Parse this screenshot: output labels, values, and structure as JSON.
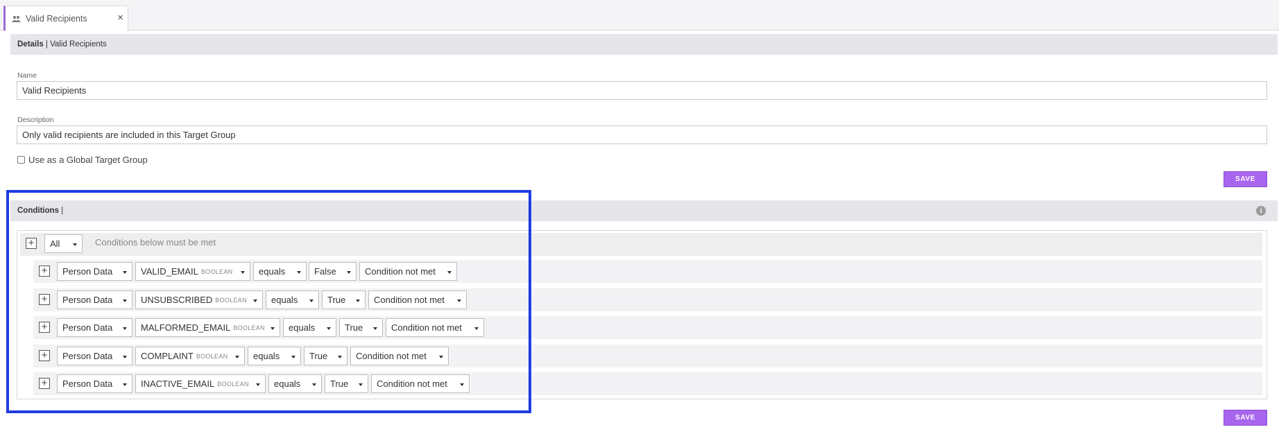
{
  "tab": {
    "title": "Valid Recipients",
    "close": "×",
    "icon": "users-icon"
  },
  "details": {
    "header_bold": "Details",
    "header_rest": " | Valid Recipients",
    "name_label": "Name",
    "name_value": "Valid Recipients",
    "description_label": "Description",
    "description_value": "Only valid recipients are included in this Target Group",
    "global_checkbox_label": "Use as a Global Target Group",
    "save_label": "SAVE"
  },
  "conditions": {
    "header_bold": "Conditions",
    "header_rest": " |",
    "info_icon": "i",
    "root_selector": "All",
    "root_text": "Conditions below must be met",
    "rows": [
      {
        "source": "Person Data",
        "field": "VALID_EMAIL",
        "type": "BOOLEAN",
        "operator": "equals",
        "value": "False",
        "negation": "Condition not met"
      },
      {
        "source": "Person Data",
        "field": "UNSUBSCRIBED",
        "type": "BOOLEAN",
        "operator": "equals",
        "value": "True",
        "negation": "Condition not met"
      },
      {
        "source": "Person Data",
        "field": "MALFORMED_EMAIL",
        "type": "BOOLEAN",
        "operator": "equals",
        "value": "True",
        "negation": "Condition not met"
      },
      {
        "source": "Person Data",
        "field": "COMPLAINT",
        "type": "BOOLEAN",
        "operator": "equals",
        "value": "True",
        "negation": "Condition not met"
      },
      {
        "source": "Person Data",
        "field": "INACTIVE_EMAIL",
        "type": "BOOLEAN",
        "operator": "equals",
        "value": "True",
        "negation": "Condition not met"
      }
    ],
    "save_label": "SAVE"
  },
  "colors": {
    "accent": "#a865ed",
    "highlight": "#1f3ce0",
    "tab_accent": "#9b6bd8"
  }
}
